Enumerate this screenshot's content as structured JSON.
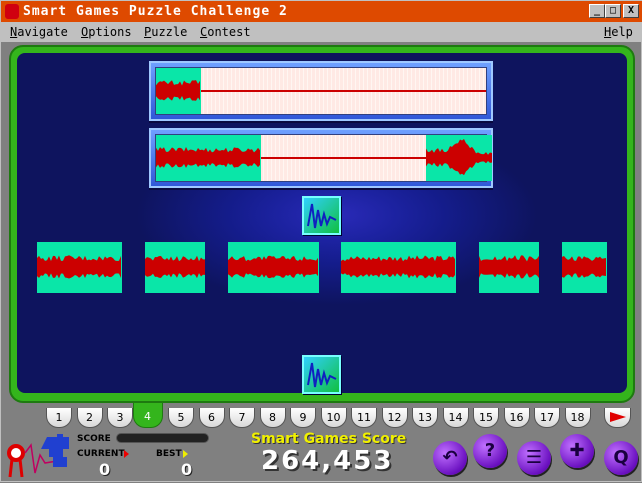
{
  "window": {
    "title": "Smart Games Puzzle Challenge 2",
    "controls": [
      "_",
      "□",
      "X"
    ]
  },
  "menu": [
    "Navigate",
    "Options",
    "Puzzle",
    "Contest",
    "Help"
  ],
  "puzzle_tabs": {
    "labels": [
      "1",
      "2",
      "3",
      "4",
      "5",
      "6",
      "7",
      "8",
      "9",
      "10",
      "11",
      "12",
      "13",
      "14",
      "15",
      "16",
      "17",
      "18"
    ],
    "selected": "4",
    "next_icon": "red-arrow-right-icon"
  },
  "status": {
    "score_label": "SCORE",
    "current_label": "CURRENT",
    "best_label": "BEST",
    "current": "0",
    "best": "0",
    "score_progress": 0
  },
  "smart_games": {
    "label": "Smart Games Score",
    "value": "264,453"
  },
  "colors": {
    "titlebar": "#de4a00",
    "frame": "#34b51c",
    "wave": "#cc0000",
    "segment": "#0ae6a8"
  },
  "buttons": [
    "undo-button",
    "help-button",
    "menu-button",
    "puzzle-button",
    "quit-button"
  ]
}
